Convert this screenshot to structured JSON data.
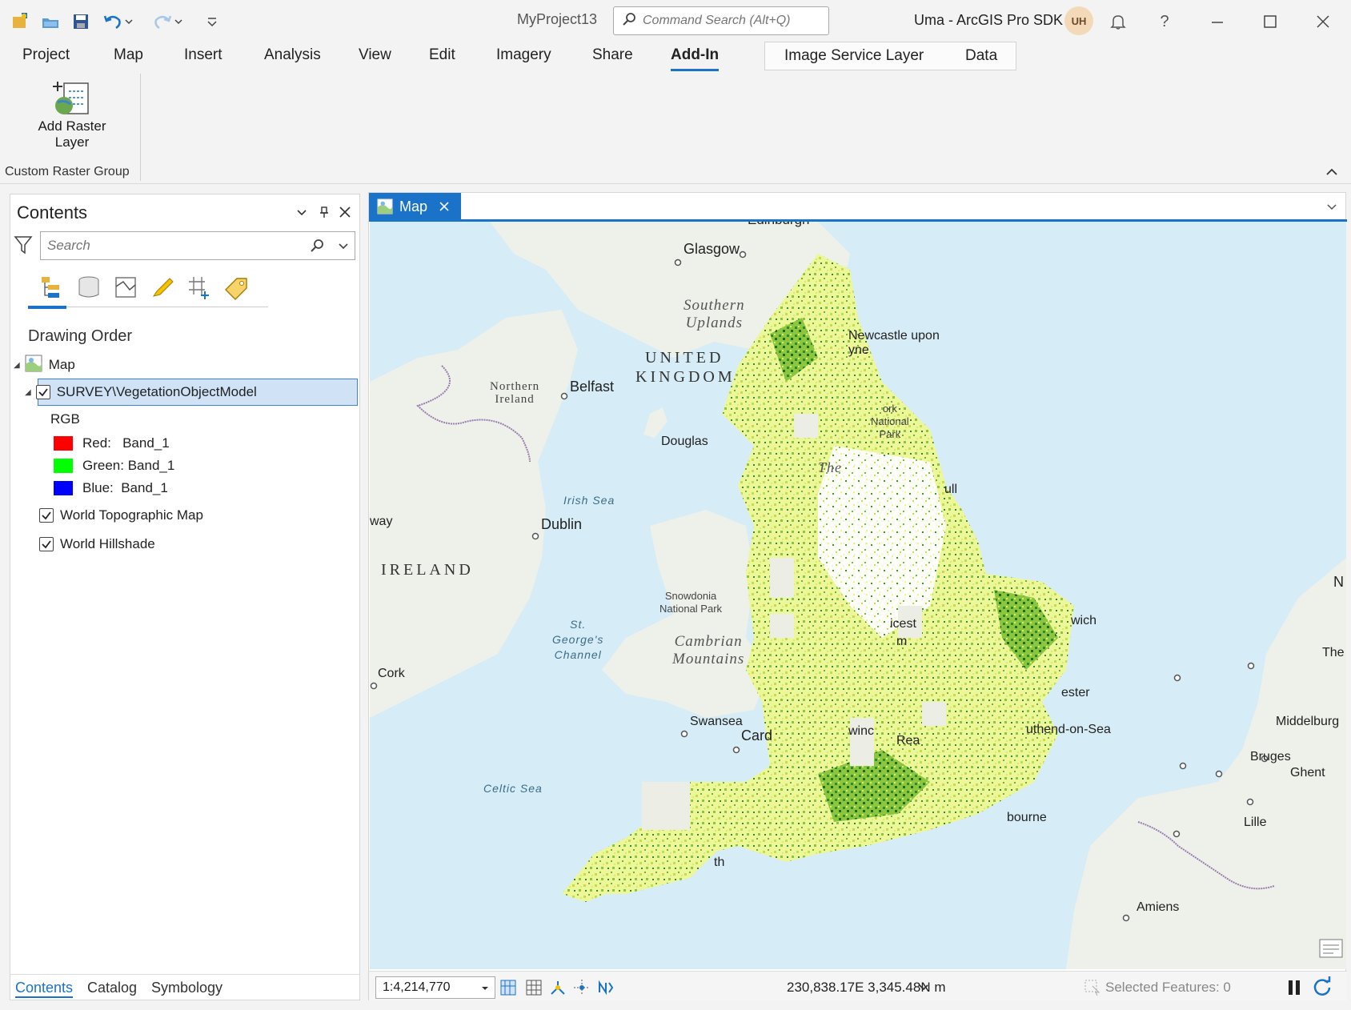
{
  "titlebar": {
    "project_name": "MyProject13",
    "command_search_placeholder": "Command Search (Alt+Q)",
    "user_label": "Uma - ArcGIS Pro SDK",
    "avatar_initials": "UH",
    "help_label": "?"
  },
  "menubar": {
    "items": [
      "Project",
      "Map",
      "Insert",
      "Analysis",
      "View",
      "Edit",
      "Imagery",
      "Share",
      "Add-In"
    ],
    "active": "Add-In",
    "context_tabs": [
      "Image Service Layer",
      "Data"
    ]
  },
  "ribbon": {
    "add_raster_label_1": "Add Raster",
    "add_raster_label_2": "Layer",
    "group_name": "Custom Raster Group"
  },
  "contents": {
    "title": "Contents",
    "search_placeholder": "Search",
    "drawing_order_label": "Drawing Order",
    "map_node": "Map",
    "layer_name": "SURVEY\\VegetationObjectModel",
    "rgb_label": "RGB",
    "bands": [
      {
        "label": "Red:   Band_1",
        "color": "#ff0000"
      },
      {
        "label": "Green: Band_1",
        "color": "#00ff00"
      },
      {
        "label": "Blue:  Band_1",
        "color": "#0000ff"
      }
    ],
    "basemaps": [
      "World Topographic Map",
      "World Hillshade"
    ],
    "bottom_tabs": [
      "Contents",
      "Catalog",
      "Symbology"
    ]
  },
  "map": {
    "tab_label": "Map",
    "scale": "1:4,214,770",
    "coordinates": "230,838.17E 3,345.48N m",
    "selected_features": "Selected Features: 0",
    "labels": {
      "edinburgh": "Edinburgh",
      "glasgow": "Glasgow",
      "southern_uplands_1": "Southern",
      "southern_uplands_2": "Uplands",
      "newcastle_1": "Newcastle upon",
      "newcastle_2": "yne",
      "uk_1": "UNITED",
      "uk_2": "KINGDOM",
      "northern_ireland_1": "Northern",
      "northern_ireland_2": "Ireland",
      "belfast": "Belfast",
      "douglas": "Douglas",
      "york_1": "ork",
      "york_2": "National",
      "york_3": "Park",
      "the": "The",
      "hull": "ull",
      "irish_sea": "Irish Sea",
      "way": "way",
      "dublin": "Dublin",
      "ireland": "IRELAND",
      "snowdonia_1": "Snowdonia",
      "snowdonia_2": "National Park",
      "leicester": "icest",
      "birmingham": "m",
      "norwich": "wich",
      "n_edge": "N",
      "st_george_1": "St.",
      "st_george_2": "George's",
      "st_george_3": "Channel",
      "cambrian_1": "Cambrian",
      "cambrian_2": "Mountains",
      "the_edge": "The",
      "cork": "Cork",
      "colchester": "ester",
      "swansea": "Swansea",
      "cardiff": "Card",
      "middelburg": "Middelburg",
      "southend": "uthend-on-Sea",
      "swindon": "winc",
      "reading": "Rea",
      "bruges": "Bruges",
      "ghent": "Ghent",
      "celtic_sea": "Celtic Sea",
      "eastbourne": "bourne",
      "lille": "Lille",
      "plymouth": "th",
      "amiens": "Amiens"
    }
  },
  "colors": {
    "accent": "#1a73c8",
    "water": "#d6ecf6",
    "land": "#eef0ea",
    "veg_light": "#e9f58a",
    "veg_mid": "#b8dc4a",
    "veg_dark": "#2e8b2e"
  }
}
